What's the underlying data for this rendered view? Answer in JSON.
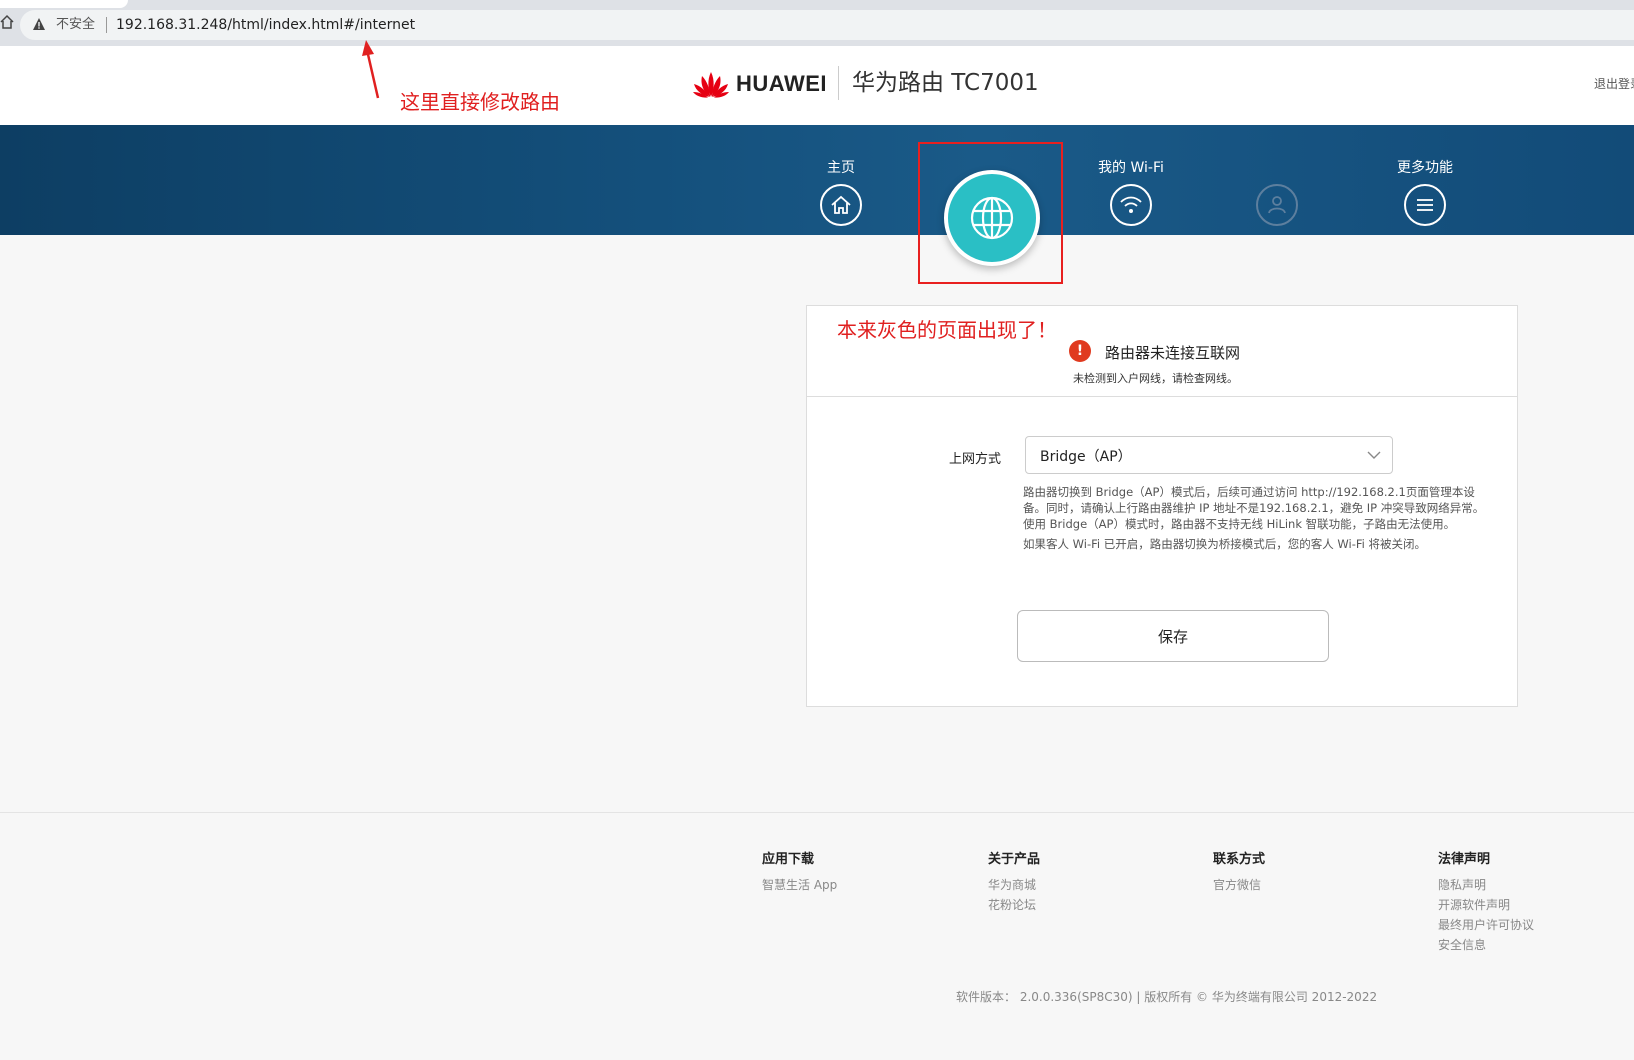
{
  "browser": {
    "not_secure": "不安全",
    "url": "192.168.31.248/html/index.html#/internet"
  },
  "annotations": {
    "url_note": "这里直接修改路由",
    "panel_note": "本来灰色的页面出现了！",
    "color": "#e02020"
  },
  "header": {
    "brand": "HUAWEI",
    "product": "华为路由 TC7001",
    "logout": "退出登录"
  },
  "nav": {
    "items": [
      {
        "label": "主页",
        "icon": "home-icon"
      },
      {
        "label": "",
        "icon": "globe-icon",
        "active": true
      },
      {
        "label": "我的 Wi-Fi",
        "icon": "wifi-icon"
      },
      {
        "label": "",
        "icon": "user-icon",
        "disabled": true
      },
      {
        "label": "更多功能",
        "icon": "menu-icon"
      }
    ],
    "active_color": "#2abfc5"
  },
  "panel": {
    "status_title": "路由器未连接互联网",
    "status_sub": "未检测到入户网线，请检查网线。",
    "mode_label": "上网方式",
    "mode_value": "Bridge（AP）",
    "desc1": "路由器切换到 Bridge（AP）模式后，后续可通过访问 http://192.168.2.1页面管理本设备。同时，请确认上行路由器维护 IP 地址不是192.168.2.1，避免 IP 冲突导致网络异常。使用 Bridge（AP）模式时，路由器不支持无线 HiLink 智联功能，子路由无法使用。",
    "desc2": "如果客人 Wi-Fi 已开启，路由器切换为桥接模式后，您的客人 Wi-Fi 将被关闭。",
    "save_label": "保存"
  },
  "footer": {
    "col1": {
      "title": "应用下载",
      "links": [
        "智慧生活 App"
      ]
    },
    "col2": {
      "title": "关于产品",
      "links": [
        "华为商城",
        "花粉论坛"
      ]
    },
    "col3": {
      "title": "联系方式",
      "links": [
        "官方微信"
      ]
    },
    "col4": {
      "title": "法律声明",
      "links": [
        "隐私声明",
        "开源软件声明",
        "最终用户许可协议",
        "安全信息"
      ]
    },
    "copyright": "软件版本： 2.0.0.336(SP8C30) | 版权所有 © 华为终端有限公司 2012-2022"
  }
}
